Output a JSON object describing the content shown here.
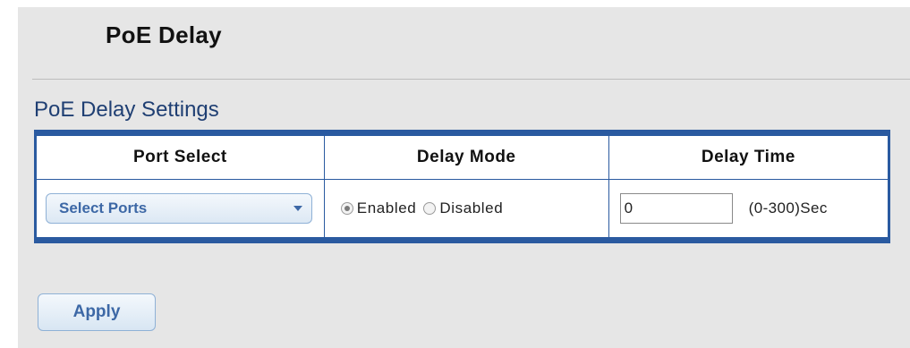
{
  "page": {
    "title": "PoE Delay"
  },
  "section": {
    "title": "PoE Delay Settings"
  },
  "table": {
    "headers": [
      "Port Select",
      "Delay Mode",
      "Delay Time"
    ],
    "port_select": {
      "label": "Select Ports",
      "icon": "chevron-down-icon"
    },
    "delay_mode": {
      "options": [
        "Enabled",
        "Disabled"
      ],
      "selected": "Enabled"
    },
    "delay_time": {
      "value": "0",
      "range_label": "(0-300)Sec"
    }
  },
  "actions": {
    "apply_label": "Apply"
  },
  "colors": {
    "accent": "#2a5aa0",
    "section_title": "#1f3f73",
    "button_text": "#3d68a6",
    "background": "#e6e6e6"
  }
}
